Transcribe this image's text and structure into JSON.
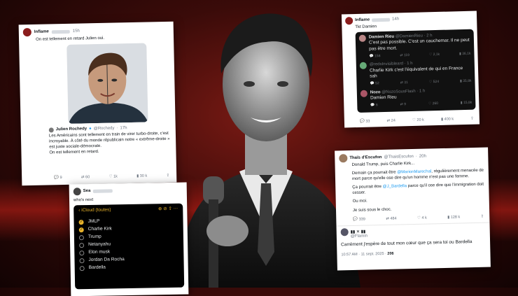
{
  "colors": {
    "accent": "#1d9bf0",
    "ios_yellow": "#e6b12a",
    "bg_red": "#a01c14"
  },
  "card1": {
    "user": "Inflame",
    "time": "15h",
    "text": "On est tellement en retard Julien oui.",
    "quote": {
      "user": "Julien Rochedy",
      "handle": "@Rochedy",
      "time": "17h",
      "text": "Les Américains sont tellement en train de virer turbo-droite, c'est incroyable. À côté du monde républicain notre « extrême-droite » est juste sociale-démocrate.\nOn est tellement en retard."
    },
    "stats": {
      "replies": "9",
      "retweets": "60",
      "likes": "1k",
      "views": "30 k"
    }
  },
  "card2": {
    "user": "Inflame",
    "time": "14h",
    "text": "Tkt Damien",
    "tweets": [
      {
        "user": "Damien Rieu",
        "handle": "@DamienRieu · 2 h",
        "text": "C'est pas possible. C'est un cauchemar. Il ne peut pas être mort.",
        "stats": [
          "158",
          "119",
          "2,1k",
          "36,1k"
        ]
      },
      {
        "user": "",
        "handle": "@redsInvisibleard · 1 h",
        "text": "Charlie Kirk c'est l'équivalent de qui en France sah",
        "stats": [
          "52",
          "31",
          "524",
          "35,8k"
        ]
      },
      {
        "user": "Nozo",
        "handle": "@NozoSousFlash · 1 h",
        "text": "Damien Rieu",
        "stats": [
          "6",
          "9",
          "260",
          "15,8k"
        ]
      }
    ],
    "stats": {
      "replies": "33",
      "retweets": "24",
      "likes": "20 k",
      "views": "400 k"
    }
  },
  "card3": {
    "user": "Sea",
    "text": "who's next",
    "header": "iCloud (toutes)",
    "items": [
      {
        "label": "JMLP",
        "checked": true
      },
      {
        "label": "Charlie Kirk",
        "checked": true
      },
      {
        "label": "Trump",
        "checked": false
      },
      {
        "label": "Netanyahu",
        "checked": false
      },
      {
        "label": "Elon musk",
        "checked": false
      },
      {
        "label": "Jordan Da Rocha",
        "checked": false
      },
      {
        "label": "Bardella",
        "checked": false
      }
    ]
  },
  "card4": {
    "user": "Thaïs d'Escufon",
    "handle": "@ThaisEscufon",
    "time": "20h",
    "line1": "Donald Trump, puis Charlie Kirk...",
    "p1a": "Demain ça pourrait être ",
    "m1": "@MarionMarechal",
    "p1b": ", régulièrement menacée de mort parce qu'elle ose dire qu'un homme n'est pas une femme.",
    "p2a": "Ça pourrait être ",
    "m2": "@J_Bardella",
    "p2b": " parce qu'il ose dire que l'immigration doit cesser.",
    "p3": "Ou moi.",
    "p4": "Je suis sous le choc.",
    "stats": {
      "replies": "339",
      "retweets": "484",
      "likes": "4 k",
      "views": "128 k"
    },
    "reply_user": "@Flamin",
    "reply": "Carrément j'espère de tout mon cœur que ça sera toi ou Bardella",
    "footer": "10:57 AM · 11 sept. 2025 · ",
    "footer_views": "206"
  }
}
